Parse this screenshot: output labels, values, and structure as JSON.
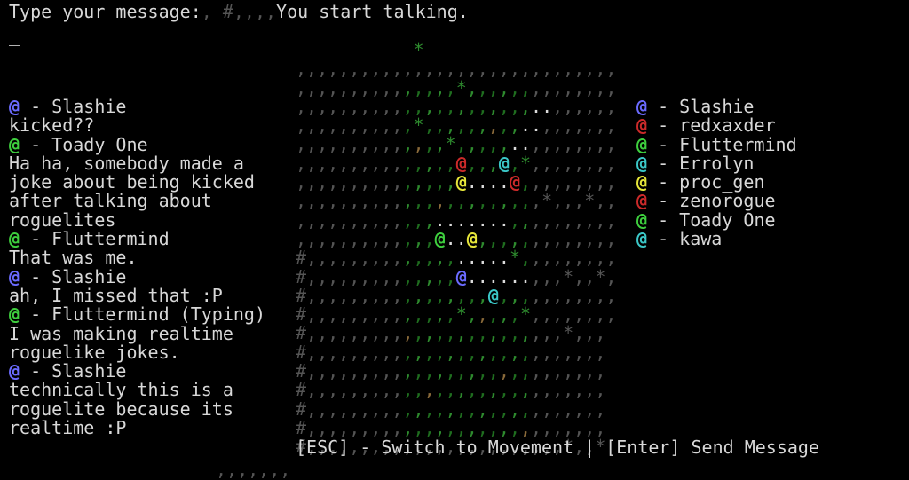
{
  "prompt": {
    "label": "Type your message:",
    "decor": ", #,,,,",
    "notice": "You start talking.",
    "cursor": "_"
  },
  "chat": [
    {
      "kind": "name",
      "icon": "@",
      "color": "#6b6bff",
      "text": " - Slashie"
    },
    {
      "kind": "msg",
      "text": "kicked??"
    },
    {
      "kind": "name",
      "icon": "@",
      "color": "#3ecf3e",
      "text": " - Toady One"
    },
    {
      "kind": "msg",
      "text": "Ha ha, somebody made a"
    },
    {
      "kind": "msg",
      "text": "joke about being kicked"
    },
    {
      "kind": "msg",
      "text": "after talking about"
    },
    {
      "kind": "msg",
      "text": "roguelites"
    },
    {
      "kind": "name",
      "icon": "@",
      "color": "#3ecf3e",
      "text": " - Fluttermind"
    },
    {
      "kind": "msg",
      "text": "That was me."
    },
    {
      "kind": "name",
      "icon": "@",
      "color": "#6b6bff",
      "text": " - Slashie"
    },
    {
      "kind": "msg",
      "text": "ah, I missed that :P"
    },
    {
      "kind": "name",
      "icon": "@",
      "color": "#3ecf3e",
      "text": " - Fluttermind (Typing)"
    },
    {
      "kind": "msg",
      "text": "I was making realtime"
    },
    {
      "kind": "msg",
      "text": "roguelike jokes."
    },
    {
      "kind": "name",
      "icon": "@",
      "color": "#6b6bff",
      "text": " - Slashie"
    },
    {
      "kind": "msg",
      "text": "technically this is a"
    },
    {
      "kind": "msg",
      "text": "roguelite because its"
    },
    {
      "kind": "msg",
      "text": "realtime :P"
    }
  ],
  "roster": [
    {
      "icon": "@",
      "color": "#6b6bff",
      "name": " - Slashie"
    },
    {
      "icon": "@",
      "color": "#cc2a2a",
      "name": " - redxaxder"
    },
    {
      "icon": "@",
      "color": "#3ecf3e",
      "name": " - Fluttermind"
    },
    {
      "icon": "@",
      "color": "#3bc8c8",
      "name": " - Errolyn"
    },
    {
      "icon": "@",
      "color": "#e6e63a",
      "name": " - proc_gen"
    },
    {
      "icon": "@",
      "color": "#cc2a2a",
      "name": " - zenorogue"
    },
    {
      "icon": "@",
      "color": "#3ecf3e",
      "name": " - Toady One"
    },
    {
      "icon": "@",
      "color": "#3bc8c8",
      "name": " - kawa"
    }
  ],
  "map": {
    "rows": [
      "           *       ",
      ",,,,,,,,,,,,,,,,,,,,,,,,,,,,,,",
      ",,,,,,,,,,,,,,,*,,,,,,,,,,,,,,",
      ",,,,,,,,,,,,,,,,,,,,,,..,,,,,,",
      ",,,,,,,,,,,*,,,,,,,,,..,,,,,,,",
      ",,,,,,,,,,,,,,*,,,,,..,,,,,,,,",
      ",,,,,,,,,,,,,,,@,,,@,*,,,,,,,,",
      ",,,,,,,,,,,,,,,@....@,,,,,,,,,",
      ",,,,,,,,,,,,,,,,,,,,,,,*,,,*,,",
      ",,,,,,,,,,,,,.......,,,,,,,,,,",
      ",,,,,,,,,,,,,@..@,,,,,,,,,,,,,",
      "#,,,,,,,,,,,,,,.....*,,,,,,,,,",
      "#,,,,,,,,,,,,,,@......,,,*,,*,",
      "#,,,,,,,,,,,,,,,,,@,,,,,,,,,,,",
      "#,,,,,,,,,,,,,,*,,,,,*,,,,,,,,",
      "#,,,,,,,,,,,,,,,,,,,,,,,,*,,,",
      "#,,,,,,,,,,,,,,,,,,,,,,,,,,,,",
      "#,,,,,,,,,,,,,,,,,,,,,,,,,,,,",
      "#,,,,,,,,,,,,,,,,,,,,,,,,,,,,",
      "#,,,,,,,,,,,,,,,,,,,,,,,,,,,,",
      "#,,,,,,,,,,,,,,,,,,,,,,,,,,,,",
      "#,,,,,,,,,,,,,,,,,,,,,,,,*,,*"
    ],
    "players": {
      "6,15": "#cc2a2a",
      "6,19": "#3bc8c8",
      "7,15": "#e6e63a",
      "7,20": "#cc2a2a",
      "10,13": "#3ecf3e",
      "10,16": "#e6e63a",
      "12,15": "#6b6bff",
      "13,18": "#3bc8c8"
    }
  },
  "help": "[ESC] - Switch to Movement | [Enter] Send Message",
  "bottom_decor": ",,,,,,,"
}
